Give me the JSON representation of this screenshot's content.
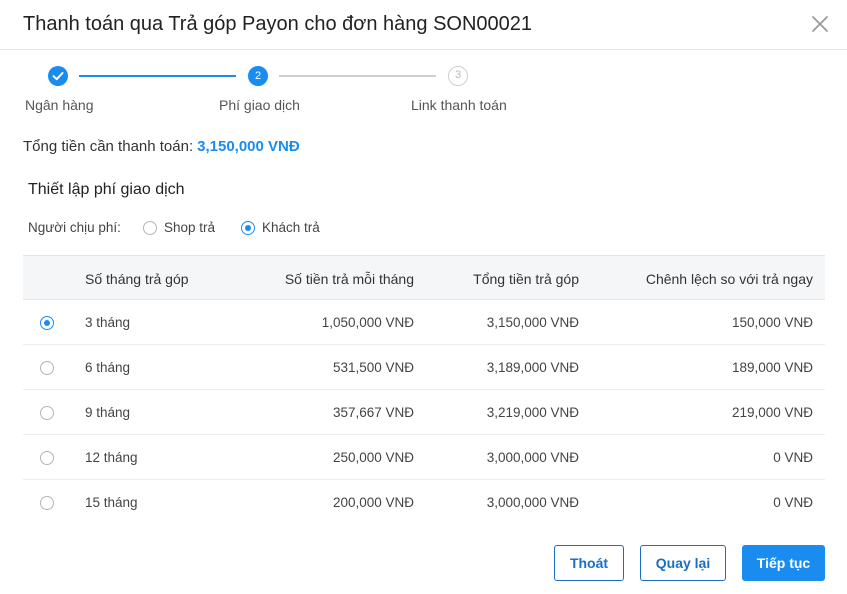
{
  "dialog": {
    "title": "Thanh toán qua Trả góp Payon cho đơn hàng SON00021"
  },
  "stepper": {
    "steps": [
      {
        "number": "1",
        "label": "Ngân hàng",
        "state": "done"
      },
      {
        "number": "2",
        "label": "Phí giao dịch",
        "state": "active"
      },
      {
        "number": "3",
        "label": "Link thanh toán",
        "state": "todo"
      }
    ]
  },
  "summary": {
    "total_label": "Tổng tiền cần thanh toán:",
    "total_value": "3,150,000 VNĐ"
  },
  "fee_settings": {
    "title": "Thiết lập phí giao dịch",
    "payer_label": "Người chịu phí:",
    "options": [
      {
        "label": "Shop trả",
        "selected": false
      },
      {
        "label": "Khách trả",
        "selected": true
      }
    ]
  },
  "table": {
    "headers": [
      "Số tháng trả góp",
      "Số tiền trả mỗi tháng",
      "Tổng tiền trả góp",
      "Chênh lệch so với trả ngay"
    ],
    "rows": [
      {
        "months": "3 tháng",
        "monthly": "1,050,000 VNĐ",
        "total": "3,150,000 VNĐ",
        "diff": "150,000 VNĐ",
        "selected": true
      },
      {
        "months": "6 tháng",
        "monthly": "531,500 VNĐ",
        "total": "3,189,000 VNĐ",
        "diff": "189,000 VNĐ",
        "selected": false
      },
      {
        "months": "9 tháng",
        "monthly": "357,667 VNĐ",
        "total": "3,219,000 VNĐ",
        "diff": "219,000 VNĐ",
        "selected": false
      },
      {
        "months": "12 tháng",
        "monthly": "250,000 VNĐ",
        "total": "3,000,000 VNĐ",
        "diff": "0 VNĐ",
        "selected": false
      },
      {
        "months": "15 tháng",
        "monthly": "200,000 VNĐ",
        "total": "3,000,000 VNĐ",
        "diff": "0 VNĐ",
        "selected": false
      }
    ]
  },
  "buttons": {
    "exit": "Thoát",
    "back": "Quay lại",
    "next": "Tiếp tục"
  },
  "colors": {
    "accent": "#1a8cf0",
    "outline_button": "#1a6fc2",
    "header_bg": "#f5f6f8"
  },
  "icons": {
    "close": "close-icon",
    "step_done": "check-icon"
  }
}
